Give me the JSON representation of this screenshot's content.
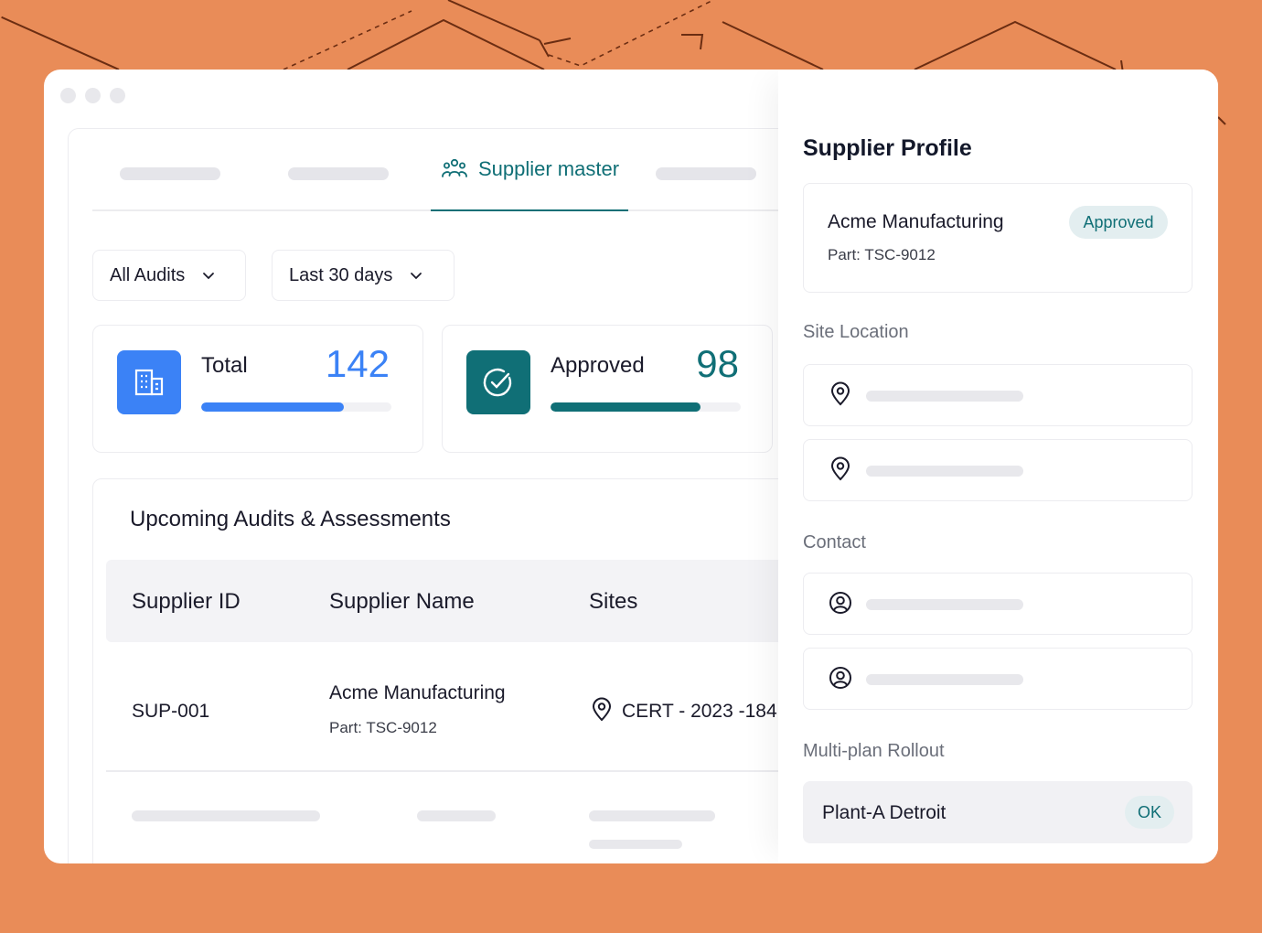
{
  "colors": {
    "background": "#e98c58",
    "accent_teal": "#106f76",
    "accent_blue": "#3b82f6",
    "line_dark": "#6b2d12"
  },
  "tabs": {
    "active_label": "Supplier master",
    "active_icon": "users-group-icon"
  },
  "filters": {
    "audit_type": {
      "selected": "All Audits",
      "icon": "chevron-down-icon"
    },
    "date_range": {
      "selected": "Last 30 days",
      "icon": "chevron-down-icon"
    }
  },
  "stats": {
    "total": {
      "label": "Total",
      "value": "142",
      "progress": 0.75,
      "icon": "building-icon",
      "color": "#3b82f6"
    },
    "approved": {
      "label": "Approved",
      "value": "98",
      "progress": 0.79,
      "icon": "check-circle-icon",
      "color": "#106f76"
    }
  },
  "audits": {
    "title": "Upcoming Audits & Assessments",
    "columns": [
      "Supplier ID",
      "Supplier Name",
      "Sites"
    ],
    "rows": [
      {
        "supplier_id": "SUP-001",
        "supplier_name": "Acme Manufacturing",
        "part": "Part: TSC-9012",
        "site": "CERT - 2023 -184",
        "site_icon": "location-pin-icon"
      }
    ]
  },
  "profile": {
    "title": "Supplier Profile",
    "name": "Acme Manufacturing",
    "part": "Part: TSC-9012",
    "status": "Approved",
    "site_location_label": "Site Location",
    "contact_label": "Contact",
    "rollout_label": "Multi-plan Rollout",
    "rollout_item": {
      "name": "Plant-A Detroit",
      "status": "OK"
    }
  }
}
